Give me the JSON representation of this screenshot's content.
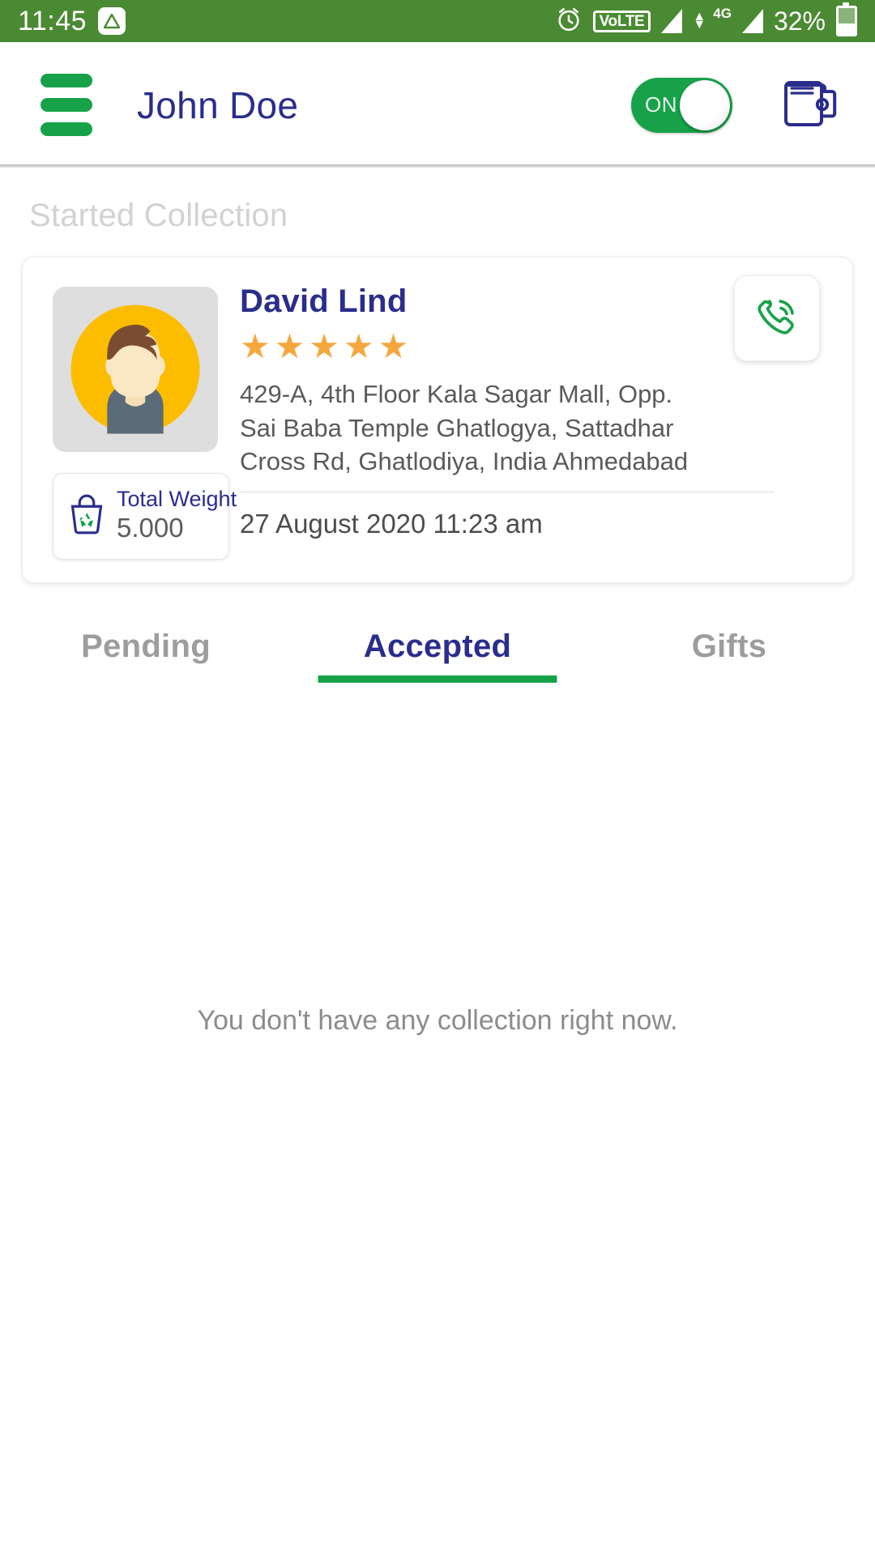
{
  "status_bar": {
    "time": "11:45",
    "app_badge_icon": "triangle-badge-icon",
    "alarm_icon": "alarm-clock-icon",
    "volte_label": "VoLTE",
    "network_label": "4G",
    "battery_percent": "32%",
    "battery_icon": "battery-charging-icon",
    "background_color": "#4a8a32"
  },
  "app_bar": {
    "menu_icon": "hamburger-menu-icon",
    "title": "John Doe",
    "toggle_label": "ON",
    "toggle_state": "on",
    "wallet_icon": "wallet-icon",
    "title_color": "#2b2d8c",
    "accent_color": "#17a24a"
  },
  "section": {
    "title": "Started Collection"
  },
  "collection": {
    "avatar_icon": "user-avatar-placeholder",
    "name": "David Lind",
    "rating": 5,
    "rating_stars": "★★★★★",
    "address": "429-A, 4th Floor Kala Sagar Mall,  Opp.\nSai Baba Temple Ghatlogya,  Sattadhar\nCross Rd,  Ghatlodiya,  India Ahmedabad",
    "date": "27 August 2020 11:23 am",
    "call_icon": "phone-call-icon",
    "weight": {
      "icon": "recycle-bag-icon",
      "label": "Total Weight",
      "value": "5.000"
    },
    "star_color": "#f5a73e"
  },
  "tabs": [
    {
      "label": "Pending",
      "active": false
    },
    {
      "label": "Accepted",
      "active": true
    },
    {
      "label": "Gifts",
      "active": false
    }
  ],
  "empty_state": {
    "message": "You don't have any collection right now."
  }
}
